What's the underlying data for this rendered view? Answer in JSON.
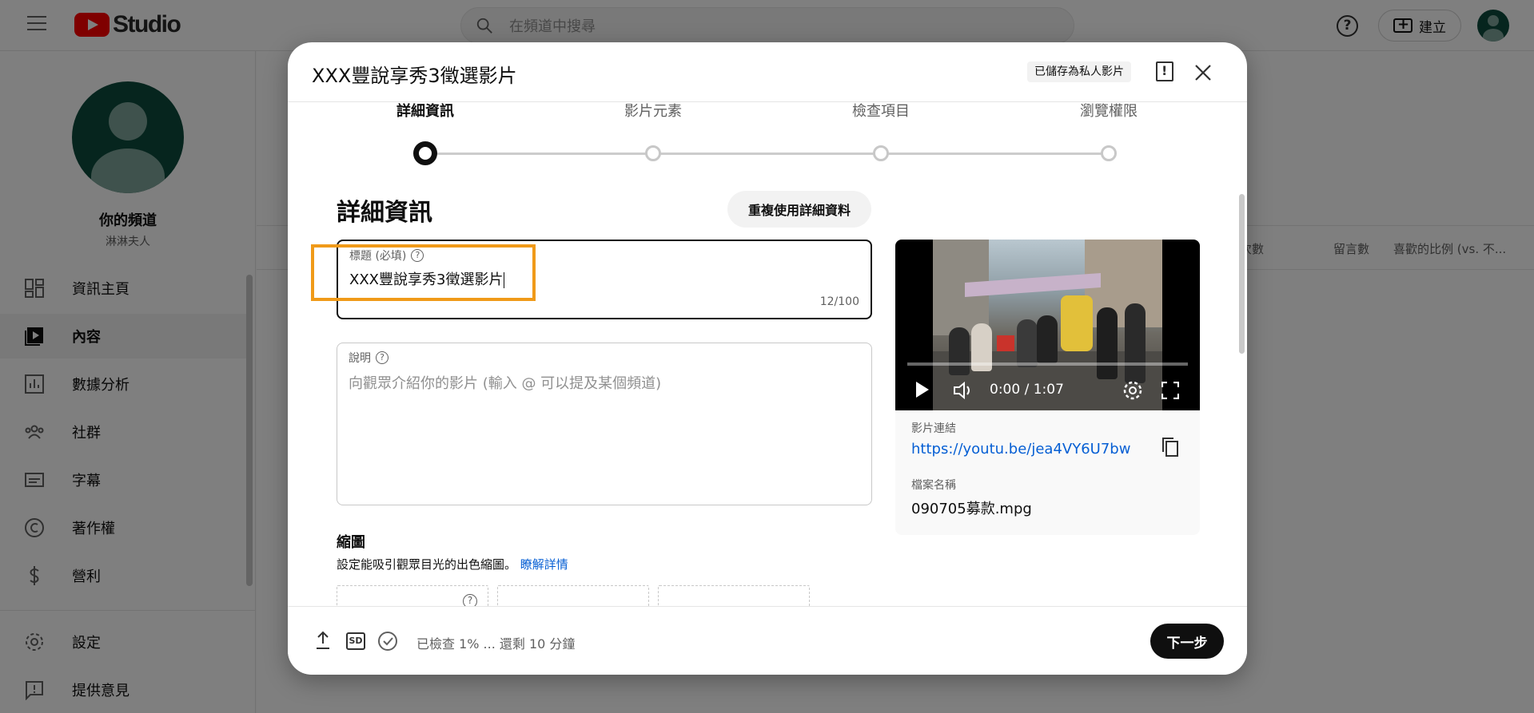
{
  "topbar": {
    "logo_text": "Studio",
    "search_placeholder": "在頻道中搜尋",
    "help_glyph": "?",
    "create_label": "建立"
  },
  "sidebar": {
    "channel_title": "你的頻道",
    "channel_name": "淋淋夫人",
    "items": [
      {
        "label": "資訊主頁",
        "icon": "dashboard-icon"
      },
      {
        "label": "內容",
        "icon": "content-icon",
        "active": true
      },
      {
        "label": "數據分析",
        "icon": "analytics-icon"
      },
      {
        "label": "社群",
        "icon": "community-icon"
      },
      {
        "label": "字幕",
        "icon": "subtitles-icon"
      },
      {
        "label": "著作權",
        "icon": "copyright-icon"
      },
      {
        "label": "營利",
        "icon": "monetization-icon"
      }
    ],
    "bottom_items": [
      {
        "label": "設定",
        "icon": "settings-icon"
      },
      {
        "label": "提供意見",
        "icon": "feedback-icon"
      }
    ]
  },
  "background_table": {
    "columns": [
      "次數",
      "留言數",
      "喜歡的比例 (vs. 不..."
    ]
  },
  "dialog": {
    "title": "XXX豐說享秀3徵選影片",
    "saved_badge": "已儲存為私人影片",
    "steps": [
      {
        "label": "詳細資訊",
        "active": true
      },
      {
        "label": "影片元素",
        "active": false
      },
      {
        "label": "檢查項目",
        "active": false
      },
      {
        "label": "瀏覽權限",
        "active": false
      }
    ],
    "section_title": "詳細資訊",
    "reuse_button": "重複使用詳細資料",
    "title_field": {
      "label": "標題 (必填)",
      "value": "XXX豐說享秀3徵選影片",
      "counter": "12/100"
    },
    "description_field": {
      "label": "說明",
      "placeholder": "向觀眾介紹你的影片 (輸入 @ 可以提及某個頻道)"
    },
    "thumbnail": {
      "title": "縮圖",
      "subtitle": "設定能吸引觀眾目光的出色縮圖。",
      "learn_more": "瞭解詳情"
    },
    "video": {
      "time": "0:00 / 1:07",
      "progress": 0,
      "link_label": "影片連結",
      "link": "https://youtu.be/jea4VY6U7bw",
      "filename_label": "檔案名稱",
      "filename": "090705募款.mpg"
    },
    "footer": {
      "sd_label": "SD",
      "status": "已檢查 1% ... 還剩 10 分鐘",
      "next_button": "下一步"
    }
  },
  "colors": {
    "highlight": "#f09a19",
    "link": "#065fd4",
    "brand_red": "#ff0000",
    "avatar_green": "#0d4a3c"
  }
}
